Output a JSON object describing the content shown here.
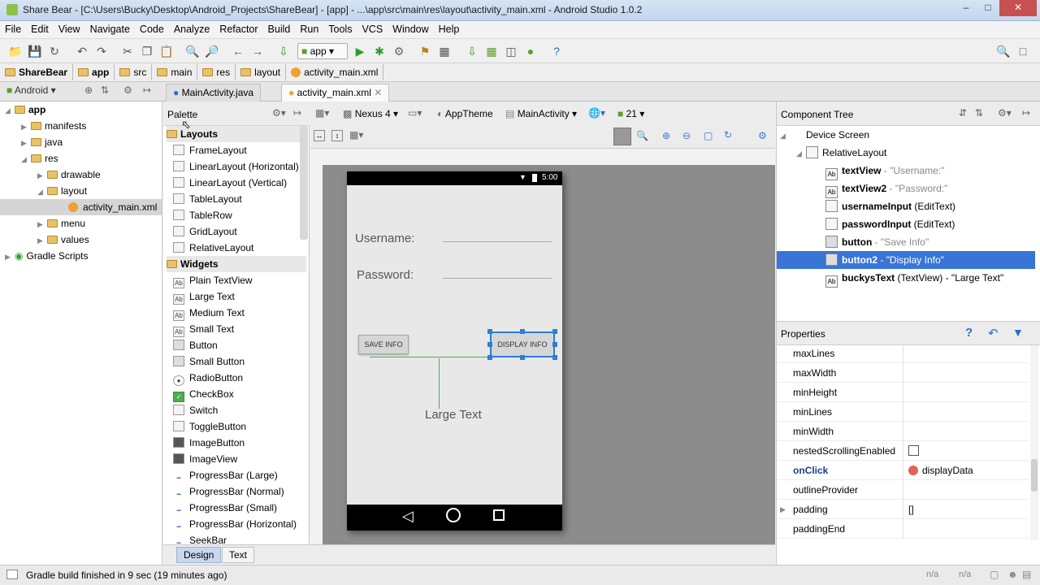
{
  "window": {
    "title": "Share Bear - [C:\\Users\\Bucky\\Desktop\\Android_Projects\\ShareBear] - [app] - ...\\app\\src\\main\\res\\layout\\activity_main.xml - Android Studio 1.0.2"
  },
  "menu": [
    "File",
    "Edit",
    "View",
    "Navigate",
    "Code",
    "Analyze",
    "Refactor",
    "Build",
    "Run",
    "Tools",
    "VCS",
    "Window",
    "Help"
  ],
  "toolbar": {
    "run_config": "app"
  },
  "breadcrumb": [
    "ShareBear",
    "app",
    "src",
    "main",
    "res",
    "layout",
    "activity_main.xml"
  ],
  "project_view": {
    "mode": "Android"
  },
  "tabs": [
    {
      "label": "MainActivity.java"
    },
    {
      "label": "activity_main.xml"
    }
  ],
  "tree": [
    {
      "label": "app"
    },
    {
      "label": "manifests"
    },
    {
      "label": "java"
    },
    {
      "label": "res"
    },
    {
      "label": "drawable"
    },
    {
      "label": "layout"
    },
    {
      "label": "activity_main.xml"
    },
    {
      "label": "menu"
    },
    {
      "label": "values"
    },
    {
      "label": "Gradle Scripts"
    }
  ],
  "palette": {
    "title": "Palette",
    "groups": [
      {
        "name": "Layouts",
        "items": [
          "FrameLayout",
          "LinearLayout (Horizontal)",
          "LinearLayout (Vertical)",
          "TableLayout",
          "TableRow",
          "GridLayout",
          "RelativeLayout"
        ]
      },
      {
        "name": "Widgets",
        "items": [
          "Plain TextView",
          "Large Text",
          "Medium Text",
          "Small Text",
          "Button",
          "Small Button",
          "RadioButton",
          "CheckBox",
          "Switch",
          "ToggleButton",
          "ImageButton",
          "ImageView",
          "ProgressBar (Large)",
          "ProgressBar (Normal)",
          "ProgressBar (Small)",
          "ProgressBar (Horizontal)",
          "SeekBar"
        ]
      }
    ]
  },
  "editor_toolbar": {
    "device": "Nexus 4",
    "theme": "AppTheme",
    "activity": "MainActivity",
    "api": "21"
  },
  "phone": {
    "time": "5:00",
    "username_label": "Username:",
    "password_label": "Password:",
    "save_button": "SAVE INFO",
    "display_button": "DISPLAY INFO",
    "large_text": "Large Text"
  },
  "component_tree": {
    "title": "Component Tree",
    "items": [
      {
        "name": "Device Screen",
        "detail": ""
      },
      {
        "name": "RelativeLayout",
        "detail": ""
      },
      {
        "name": "textView",
        "detail": " - \"Username:\""
      },
      {
        "name": "textView2",
        "detail": " - \"Password:\""
      },
      {
        "name": "usernameInput",
        "detail": " (EditText)"
      },
      {
        "name": "passwordInput",
        "detail": " (EditText)"
      },
      {
        "name": "button",
        "detail": " - \"Save Info\""
      },
      {
        "name": "button2",
        "detail": " - \"Display Info\""
      },
      {
        "name": "buckysText",
        "detail": " (TextView) - \"Large Text\""
      }
    ]
  },
  "properties": {
    "title": "Properties",
    "rows": [
      {
        "key": "maxLines",
        "value": ""
      },
      {
        "key": "maxWidth",
        "value": ""
      },
      {
        "key": "minHeight",
        "value": ""
      },
      {
        "key": "minLines",
        "value": ""
      },
      {
        "key": "minWidth",
        "value": ""
      },
      {
        "key": "nestedScrollingEnabled",
        "value": ""
      },
      {
        "key": "onClick",
        "value": "displayData"
      },
      {
        "key": "outlineProvider",
        "value": ""
      },
      {
        "key": "padding",
        "value": "[]"
      },
      {
        "key": "paddingEnd",
        "value": ""
      }
    ]
  },
  "bottom_tabs": [
    "Design",
    "Text"
  ],
  "status": {
    "message": "Gradle build finished in 9 sec (19 minutes ago)",
    "na1": "n/a",
    "na2": "n/a"
  },
  "colors": {
    "selection": "#3875d7",
    "accent_green": "#4caf50"
  }
}
